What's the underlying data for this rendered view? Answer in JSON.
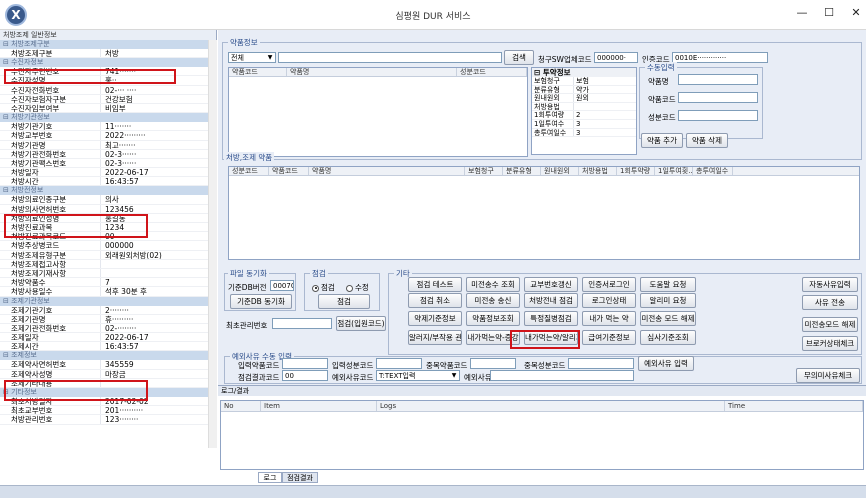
{
  "window": {
    "title": "심평원 DUR 서비스",
    "min": "—",
    "max": "☐",
    "close": "✕",
    "logo": "X"
  },
  "left": {
    "header": "처방조제 일반정보",
    "sections": [
      {
        "title": "처방조제구분",
        "rows": [
          [
            "처방조제구분",
            "처방"
          ]
        ]
      },
      {
        "title": "수진자정보",
        "rows": [
          [
            "수진자주민번호",
            "741·······"
          ],
          [
            "수진자성명",
            "홍··"
          ],
          [
            "수진자전화번호",
            "02-··· ····"
          ],
          [
            "수진자보험자구분",
            "건강보험"
          ],
          [
            "수진자임부여부",
            "비임부"
          ]
        ]
      },
      {
        "title": "처방기관정보",
        "rows": [
          [
            "처방기관기호",
            "11·······"
          ],
          [
            "처방교부번호",
            "2022·········"
          ],
          [
            "처방기관명",
            "최고·······"
          ],
          [
            "처방기관전화번호",
            "02-3······"
          ],
          [
            "처방기관팩스번호",
            "02-3······"
          ],
          [
            "처방일자",
            "2022-06-17"
          ],
          [
            "처방시간",
            "16:43:57"
          ]
        ]
      },
      {
        "title": "처방전정보",
        "rows": [
          [
            "처방의료인종구분",
            "의사"
          ],
          [
            "처방의사면허번호",
            "123456"
          ],
          [
            "처방의료인성명",
            "홍길동"
          ],
          [
            "처방진료과목",
            "1234"
          ],
          [
            "처방진료과목코드",
            "00"
          ],
          [
            "처방주상병코드",
            "000000"
          ],
          [
            "처방조제유형구분",
            "외래원외처방(02)"
          ],
          [
            "처방조제접고사항",
            ""
          ],
          [
            "처방조제기재사항",
            ""
          ],
          [
            "처방약품수",
            "7"
          ],
          [
            "처방사용일수",
            "석후 30분 후"
          ]
        ]
      },
      {
        "title": "조제기관정보",
        "rows": [
          [
            "조제기관기호",
            "2········"
          ],
          [
            "조제기관명",
            "휴·········"
          ],
          [
            "조제기관전화번호",
            "02-········"
          ],
          [
            "조제일자",
            "2022-06-17"
          ],
          [
            "조제시간",
            "16:43:57"
          ]
        ]
      },
      {
        "title": "조제정보",
        "rows": [
          [
            "조제약사면허번호",
            "345559"
          ],
          [
            "조제약사성명",
            "마장금"
          ],
          [
            "조제기타내용",
            ""
          ]
        ]
      },
      {
        "title": "기타정보",
        "rows": [
          [
            "최초처방일자",
            "2017-02-02"
          ],
          [
            "최초교부번호",
            "201··········"
          ],
          [
            "처방관리번호",
            "123········"
          ]
        ]
      }
    ]
  },
  "drug_info": {
    "label": "약품정보",
    "search_type": "전체",
    "search_value": "",
    "search_btn": "검색",
    "claim_sw_label": "청구SW업체코드",
    "claim_sw_value": "000000·",
    "cert_label": "인증코드",
    "cert_value": "0010E·············",
    "columns": [
      "약품코드",
      "약품명",
      "성분코드"
    ]
  },
  "tuyak": {
    "title": "투약정보",
    "rows": [
      [
        "보험청구",
        "보험"
      ],
      [
        "분류유형",
        "약가"
      ],
      [
        "원내원외",
        "원외"
      ],
      [
        "처방용법",
        ""
      ],
      [
        "1회투여량",
        "2"
      ],
      [
        "1일투여수",
        "3"
      ],
      [
        "총투여일수",
        "3"
      ]
    ]
  },
  "manual": {
    "title": "수동입력",
    "labels": [
      "약품명",
      "약품코드",
      "성분코드"
    ],
    "add_btn": "약품 추가",
    "del_btn": "약품 삭제"
  },
  "rx_drugs": {
    "label": "처방,조제 약품",
    "columns": [
      "성분코드",
      "약품코드",
      "약품명",
      "보험청구",
      "분류유형",
      "원내원외",
      "처방용법",
      "1회투약량",
      "1일투여횟...",
      "총투여일수"
    ]
  },
  "file_sync": {
    "label": "파일 동기화",
    "base_db_label": "기준DB버전",
    "base_db_value": "000702",
    "sync_btn": "기준DB 동기화"
  },
  "check": {
    "label": "점검",
    "opt1": "점검",
    "opt2": "수정",
    "btn": "점검"
  },
  "mgmt": {
    "label": "최초관리번호",
    "value": "",
    "btn": "점검(입원코드)"
  },
  "etc": {
    "label": "기타",
    "buttons": [
      [
        "점검 테스트",
        "미전송수 조회",
        "교부번호갱신",
        "인증서로그인",
        "도움말 요청"
      ],
      [
        "점검 취소",
        "미전송 송신",
        "처방전내 점검",
        "로그인상태",
        "알리미 요청"
      ],
      [
        "약제기준정보",
        "약품정보조회",
        "특정질병점검",
        "내가 먹는 약",
        "미전송 모드 해제"
      ],
      [
        "알러지/부작용 관리",
        "내가먹는약-증강",
        "내가먹는약/알리지",
        "급여기준정보",
        "심사기준조회"
      ]
    ],
    "right_buttons": [
      "자동사유입력",
      "사유 전송",
      "미전송모드 해제",
      "브로커상태체크"
    ]
  },
  "exception": {
    "label": "예외사유 수동 입력",
    "row1": [
      "입력약품코드",
      "입력성분코드",
      "중복약품코드",
      "중복성분코드",
      "예외사유 입력"
    ],
    "row2_label": "점검결과코드",
    "row2_value": "00",
    "reason_code_label": "예외사유코드",
    "reason_code_value": "T:TEXT입력",
    "reason_label": "예외사유",
    "no_reason_btn": "무의미사유체크"
  },
  "log": {
    "label": "로그/결과",
    "columns": [
      "No",
      "Item",
      "Logs",
      "Time"
    ],
    "tabs": [
      "로그",
      "점검결과"
    ]
  }
}
